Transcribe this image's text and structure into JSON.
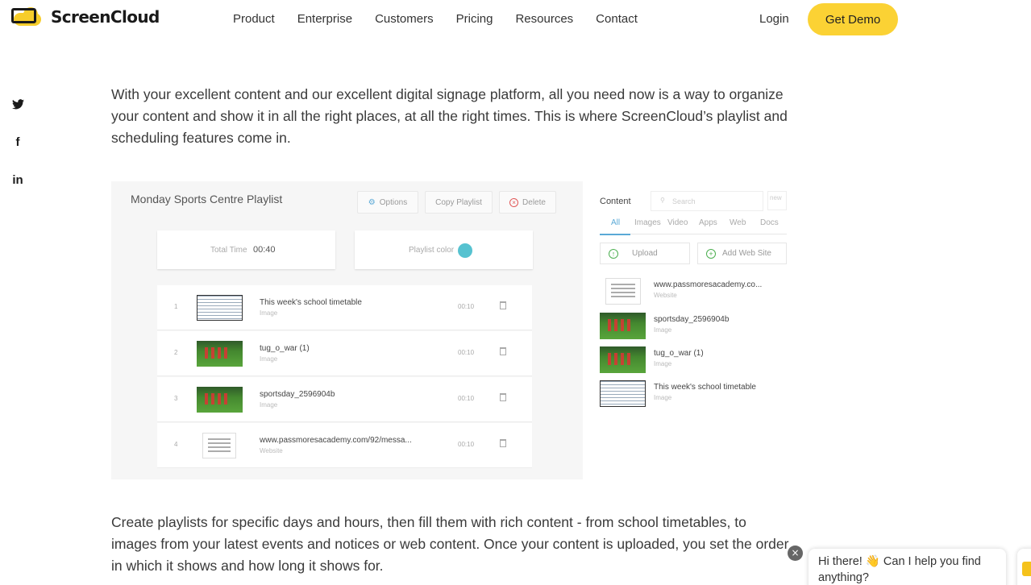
{
  "header": {
    "brand": "ScreenCloud",
    "nav": [
      "Product",
      "Enterprise",
      "Customers",
      "Pricing",
      "Resources",
      "Contact"
    ],
    "login": "Login",
    "demo": "Get Demo"
  },
  "social": {
    "twitter": "t",
    "facebook": "f",
    "linkedin": "in"
  },
  "article": {
    "intro": "With your excellent content and our excellent digital signage platform, all you need now is a way to organize your content and show it in all the right places, at all the right times. This is where ScreenCloud’s playlist and scheduling features come in.",
    "body": "Create playlists for specific days and hours, then fill them with rich content - from school timetables, to images from your latest events and notices or web content. Once your content is uploaded, you set the order in which it shows and how long it shows for."
  },
  "playlist": {
    "title": "Monday Sports Centre Playlist",
    "options": "Options",
    "copy": "Copy Playlist",
    "delete": "Delete",
    "total_time_label": "Total Time",
    "total_time": "00:40",
    "color_label": "Playlist color",
    "color": "#56c2d0",
    "items": [
      {
        "num": "1",
        "name": "This week's school timetable",
        "type": "Image",
        "time": "00:10"
      },
      {
        "num": "2",
        "name": "tug_o_war (1)",
        "type": "Image",
        "time": "00:10"
      },
      {
        "num": "3",
        "name": "sportsday_2596904b",
        "type": "Image",
        "time": "00:10"
      },
      {
        "num": "4",
        "name": "www.passmoresacademy.com/92/messa...",
        "type": "Website",
        "time": "00:10"
      }
    ]
  },
  "content": {
    "title": "Content",
    "search": "Search",
    "new": "new",
    "tabs": [
      "All",
      "Images",
      "Video",
      "Apps",
      "Web",
      "Docs"
    ],
    "upload": "Upload",
    "add_site": "Add Web Site",
    "items": [
      {
        "name": "www.passmoresacademy.co...",
        "type": "Website"
      },
      {
        "name": "sportsday_2596904b",
        "type": "Image"
      },
      {
        "name": "tug_o_war (1)",
        "type": "Image"
      },
      {
        "name": "This week's school timetable",
        "type": "Image"
      }
    ]
  },
  "chat": {
    "close": "×",
    "message": "Hi there! 👋 Can I help you find anything?"
  }
}
